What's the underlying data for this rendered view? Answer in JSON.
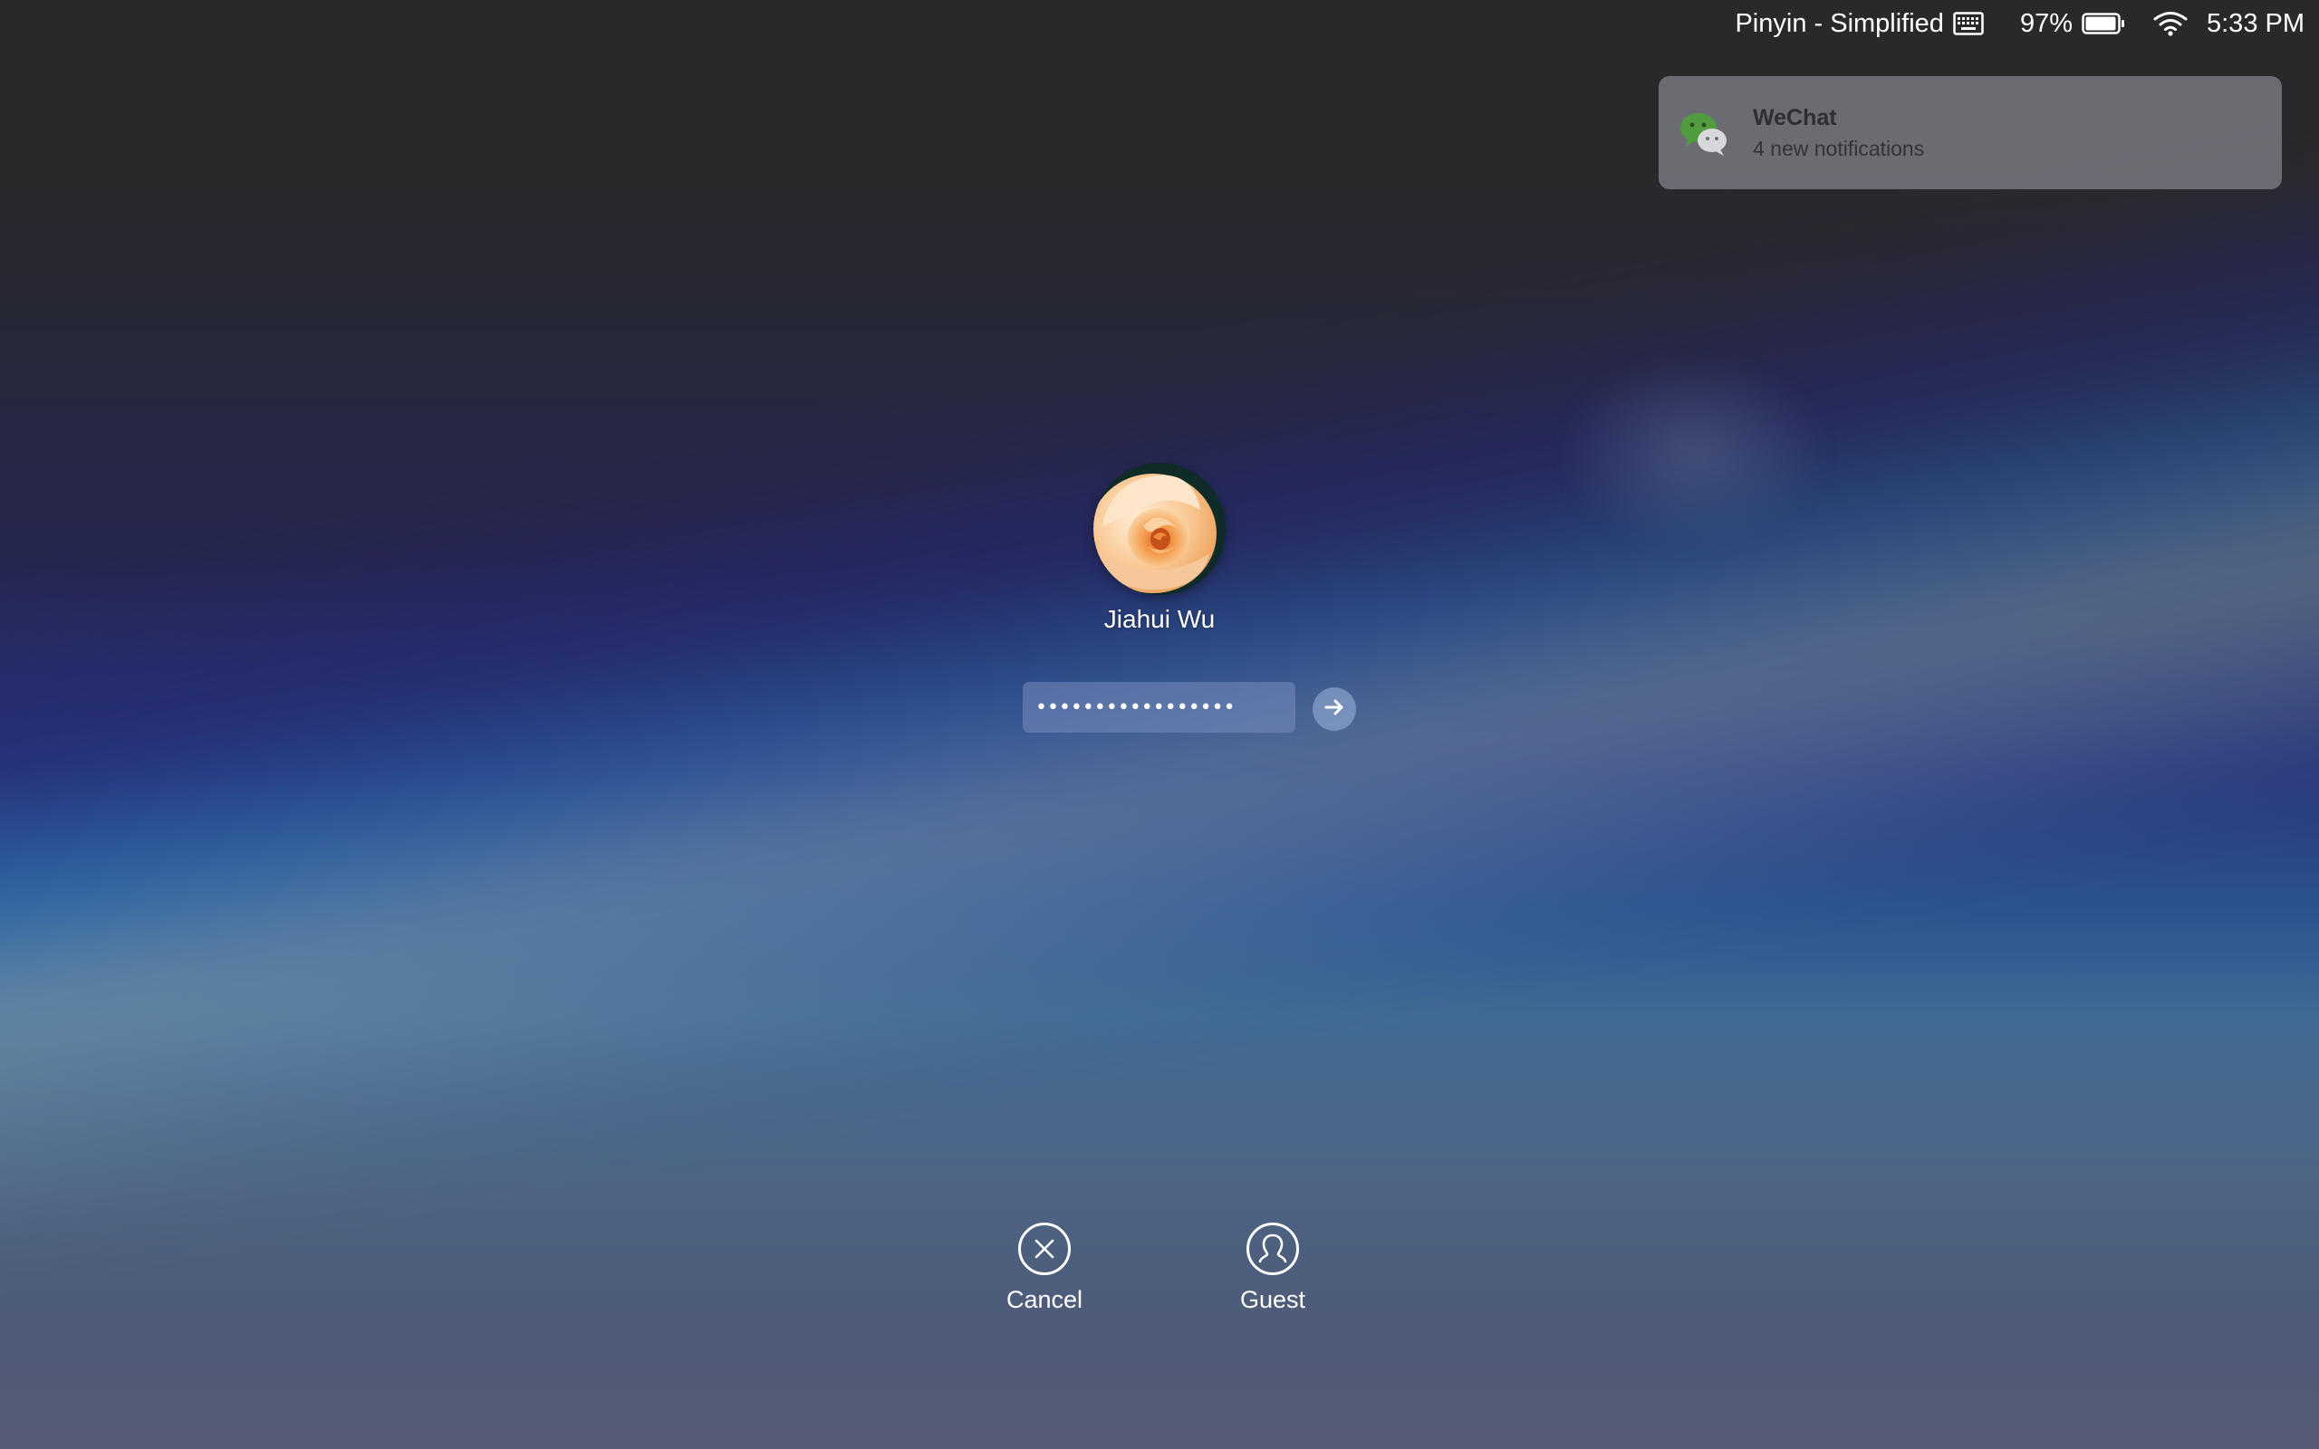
{
  "menubar": {
    "input_source": "Pinyin - Simplified",
    "keyboard_icon": "keyboard-icon",
    "battery_percent": "97%",
    "battery_level": 0.97,
    "battery_icon": "battery-icon",
    "wifi_icon": "wifi-icon",
    "time": "5:33 PM"
  },
  "notification": {
    "app_icon": "wechat-icon",
    "app_name": "WeChat",
    "message": "4 new notifications"
  },
  "login": {
    "avatar_icon": "rose-avatar",
    "user_name": "Jiahui Wu",
    "password_mask": "•••••••••••••••••",
    "submit_icon": "arrow-right-icon"
  },
  "actions": {
    "cancel_label": "Cancel",
    "cancel_icon": "close-circle-icon",
    "guest_label": "Guest",
    "guest_icon": "guest-user-icon"
  },
  "colors": {
    "accent_green": "#4caf50",
    "text": "#ffffff"
  }
}
